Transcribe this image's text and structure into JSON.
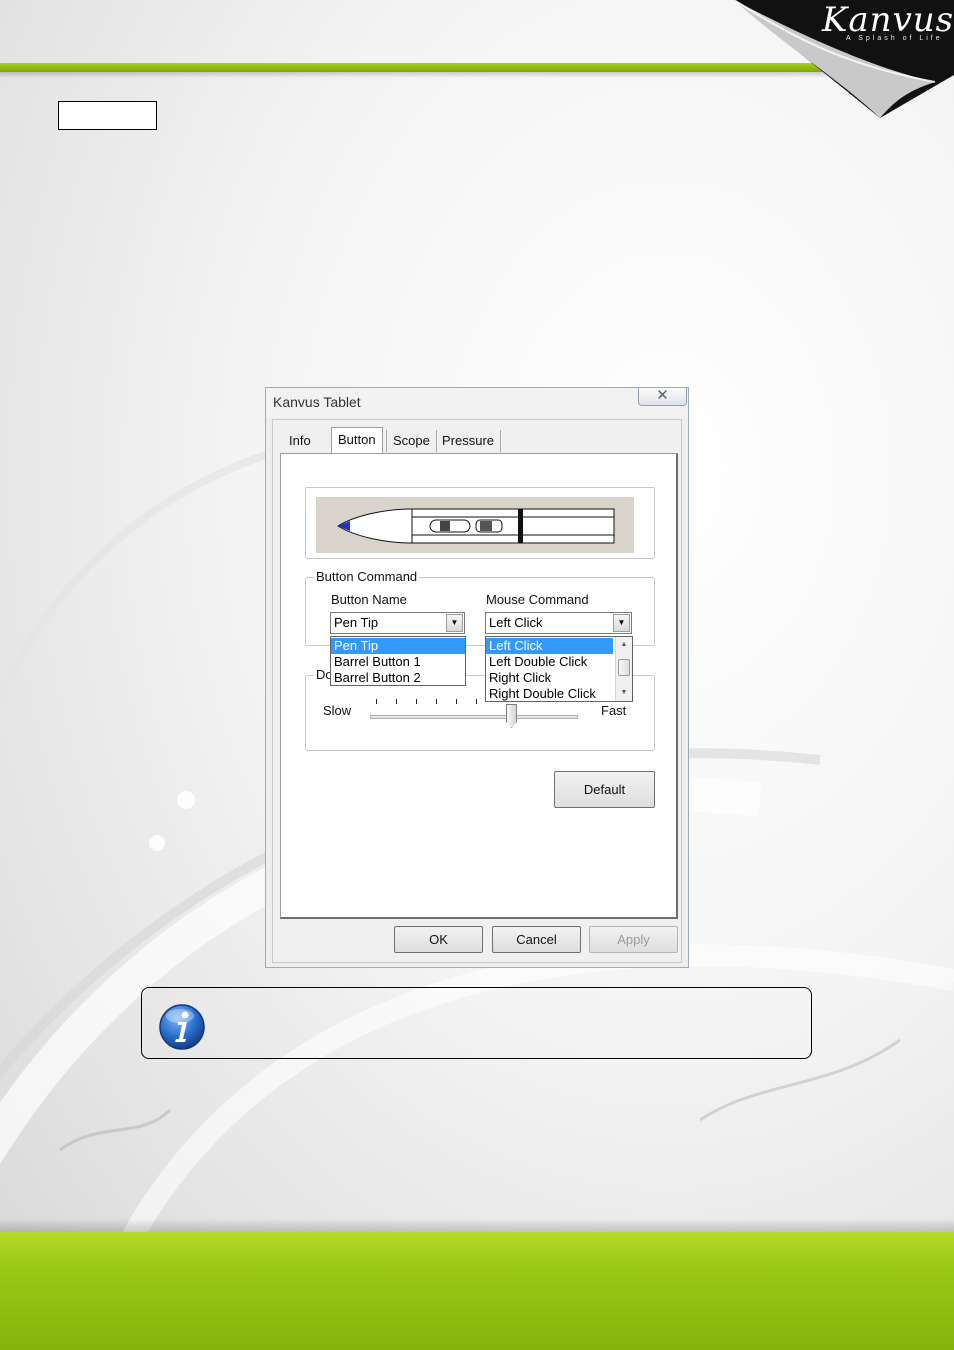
{
  "brand": {
    "logo_text": "Kanvus",
    "tagline": "A Splash of Life",
    "accent_color": "#8cbc10"
  },
  "dialog": {
    "title": "Kanvus Tablet",
    "close_glyph": "✕",
    "tabs": [
      {
        "label": "Info",
        "active": false
      },
      {
        "label": "Button",
        "active": true
      },
      {
        "label": "Scope",
        "active": false
      },
      {
        "label": "Pressure",
        "active": false
      }
    ],
    "button_command": {
      "legend": "Button Command",
      "button_name_label": "Button Name",
      "mouse_command_label": "Mouse Command",
      "button_name_value": "Pen Tip",
      "mouse_command_value": "Left Click",
      "button_name_options": [
        "Pen Tip",
        "Barrel Button 1",
        "Barrel Button 2"
      ],
      "mouse_command_options": [
        "Left Click",
        "Left Double Click",
        "Right Click",
        "Right Double Click"
      ],
      "selected_button_name_index": 0,
      "selected_mouse_command_index": 0
    },
    "speed": {
      "legend_fragment": "Do",
      "slow_label": "Slow",
      "fast_label": "Fast",
      "level_fraction": 0.68
    },
    "buttons": {
      "default": "Default",
      "ok": "OK",
      "cancel": "Cancel",
      "apply": "Apply"
    }
  },
  "info_note": {
    "icon": "info-icon",
    "icon_color": "#1f5fae"
  }
}
